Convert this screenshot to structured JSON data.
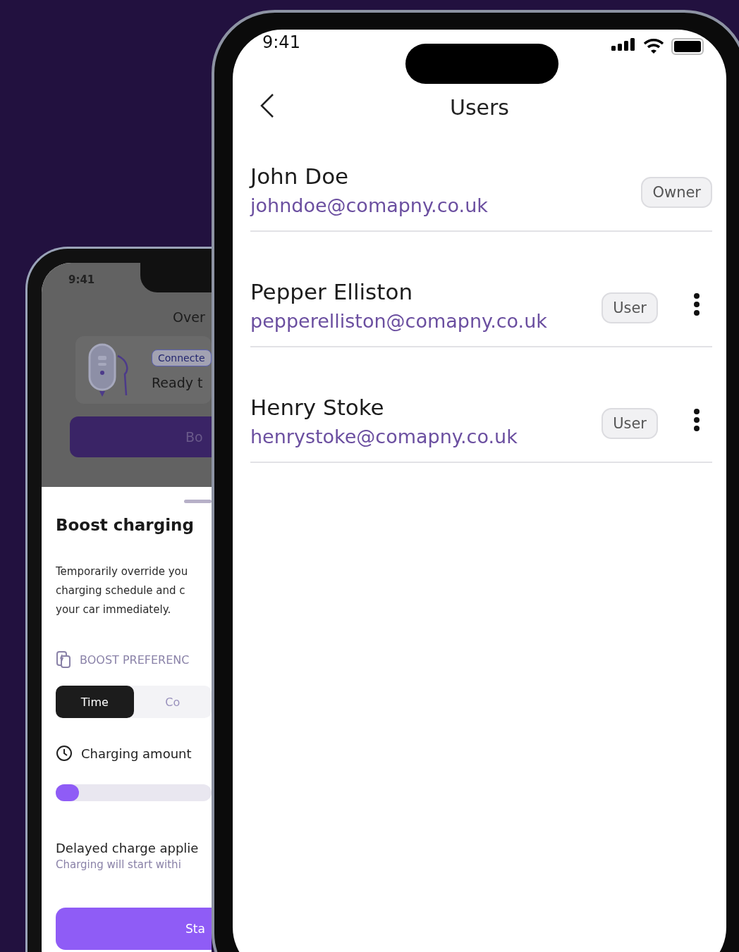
{
  "back_phone": {
    "status_time": "9:41",
    "title": "Over",
    "charger": {
      "badge": "Connecte",
      "status": "Ready t",
      "button": "Bo"
    },
    "sheet": {
      "title": "Boost charging",
      "description": [
        "Temporarily override you",
        "charging schedule and c",
        "your car immediately."
      ],
      "section_label": "BOOST PREFERENC",
      "options": [
        {
          "label": "Time",
          "selected": true
        },
        {
          "label": "Co",
          "selected": false
        }
      ],
      "amount_label": "Charging amount",
      "amount": {
        "level": 0.15
      },
      "notice_title": "Delayed charge applie",
      "notice_text": "Charging will start withi",
      "start_button": "Sta"
    }
  },
  "front_phone": {
    "status_time": "9:41",
    "title": "Users",
    "users": [
      {
        "name": "John Doe",
        "email": "johndoe@comapny.co.uk",
        "role": "Owner",
        "has_menu": false
      },
      {
        "name": "Pepper Elliston",
        "email": "pepperelliston@comapny.co.uk",
        "role": "User",
        "has_menu": true
      },
      {
        "name": "Henry Stoke",
        "email": "henrystoke@comapny.co.uk",
        "role": "User",
        "has_menu": true
      }
    ]
  }
}
